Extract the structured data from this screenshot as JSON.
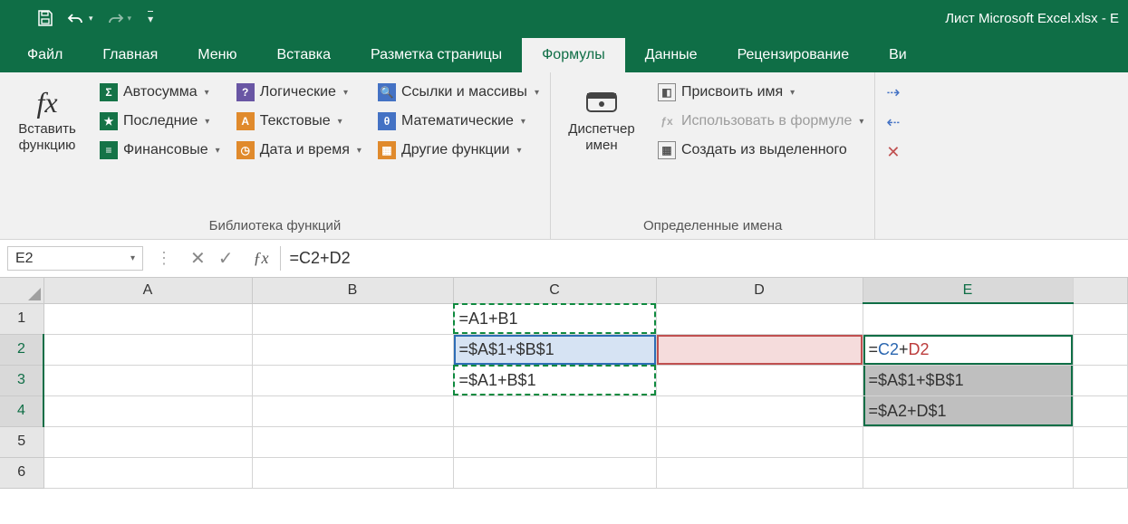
{
  "titlebar": {
    "title": "Лист Microsoft Excel.xlsx - E"
  },
  "tabs": {
    "file": "Файл",
    "home": "Главная",
    "menu": "Меню",
    "insert": "Вставка",
    "layout": "Разметка страницы",
    "formulas": "Формулы",
    "data": "Данные",
    "review": "Рецензирование",
    "view": "Ви"
  },
  "ribbon": {
    "insert_function": "Вставить\nфункцию",
    "autosum": "Автосумма",
    "recent": "Последние",
    "financial": "Финансовые",
    "logical": "Логические",
    "text": "Текстовые",
    "datetime": "Дата и время",
    "lookup": "Ссылки и массивы",
    "math": "Математические",
    "more": "Другие функции",
    "library_label": "Библиотека функций",
    "name_manager": "Диспетчер\nимен",
    "define_name": "Присвоить имя",
    "use_in_formula": "Использовать в формуле",
    "create_from_selection": "Создать из выделенного",
    "names_label": "Определенные имена"
  },
  "formula_bar": {
    "name_box": "E2",
    "formula": "=C2+D2"
  },
  "grid": {
    "columns": [
      "A",
      "B",
      "C",
      "D",
      "E"
    ],
    "rows": [
      "1",
      "2",
      "3",
      "4",
      "5",
      "6"
    ],
    "cells": {
      "C1": "=A1+B1",
      "C2": "=$A$1+$B$1",
      "C3": "=$A1+B$1",
      "E3": "=$A$1+$B$1",
      "E4": "=$A2+D$1"
    },
    "E2_parts": {
      "eq": "=",
      "a": "C2",
      "plus": "+",
      "b": "D2"
    }
  }
}
